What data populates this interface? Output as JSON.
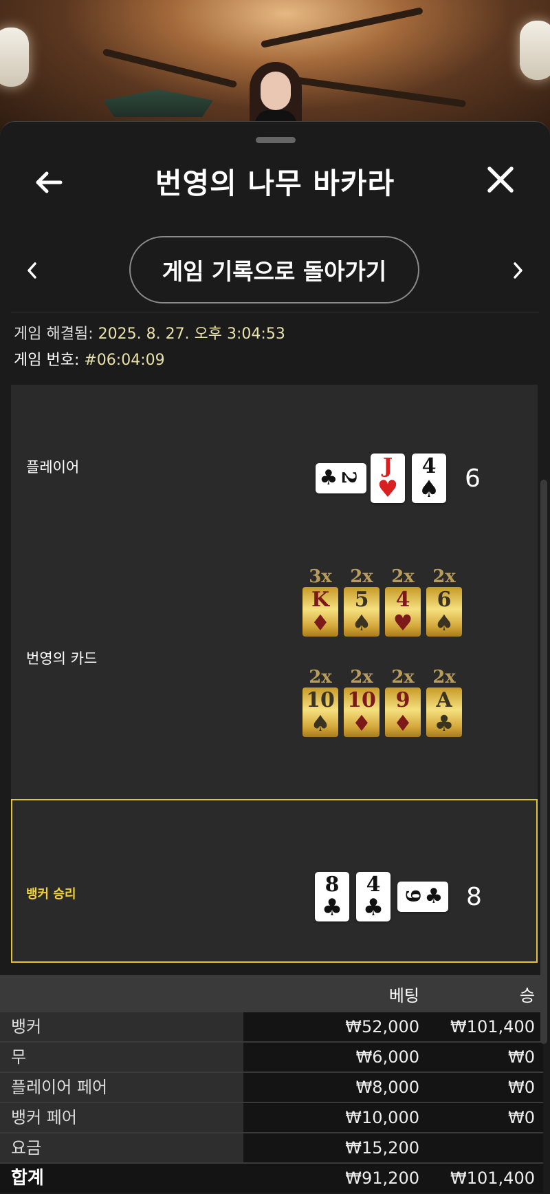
{
  "header": {
    "title": "번영의 나무 바카라"
  },
  "nav": {
    "return_label": "게임 기록으로 돌아가기"
  },
  "meta": {
    "resolved_label": "게임 해결됨:",
    "resolved_value": "2025. 8. 27. 오후 3:04:53",
    "game_no_label": "게임 번호:",
    "game_no_value": "#06:04:09"
  },
  "player": {
    "label": "플레이어",
    "total": "6",
    "cards": [
      {
        "rank": "2",
        "suit": "♣",
        "color": "black",
        "orientation": "sideways"
      },
      {
        "rank": "J",
        "suit": "♥",
        "color": "red"
      },
      {
        "rank": "4",
        "suit": "♠",
        "color": "black"
      }
    ]
  },
  "prosperity": {
    "label": "번영의 카드",
    "row1": [
      {
        "mult": "3x",
        "rank": "K",
        "suit": "♦",
        "color": "red"
      },
      {
        "mult": "2x",
        "rank": "5",
        "suit": "♠",
        "color": "black"
      },
      {
        "mult": "2x",
        "rank": "4",
        "suit": "♥",
        "color": "red"
      },
      {
        "mult": "2x",
        "rank": "6",
        "suit": "♠",
        "color": "black"
      }
    ],
    "row2": [
      {
        "mult": "2x",
        "rank": "10",
        "suit": "♠",
        "color": "black"
      },
      {
        "mult": "2x",
        "rank": "10",
        "suit": "♦",
        "color": "red"
      },
      {
        "mult": "2x",
        "rank": "9",
        "suit": "♦",
        "color": "red"
      },
      {
        "mult": "2x",
        "rank": "A",
        "suit": "♣",
        "color": "black"
      }
    ]
  },
  "banker": {
    "label": "뱅커 승리",
    "total": "8",
    "cards": [
      {
        "rank": "8",
        "suit": "♣",
        "color": "black"
      },
      {
        "rank": "4",
        "suit": "♣",
        "color": "black"
      },
      {
        "rank": "9",
        "suit": "♣",
        "color": "black",
        "orientation": "sideways"
      }
    ]
  },
  "bets": {
    "col_bet": "베팅",
    "col_win": "승",
    "rows": [
      {
        "name": "뱅커",
        "bet": "₩52,000",
        "win": "₩101,400"
      },
      {
        "name": "무",
        "bet": "₩6,000",
        "win": "₩0"
      },
      {
        "name": "플레이어 페어",
        "bet": "₩8,000",
        "win": "₩0"
      },
      {
        "name": "뱅커 페어",
        "bet": "₩10,000",
        "win": "₩0"
      },
      {
        "name": "요금",
        "bet": "₩15,200",
        "win": ""
      }
    ],
    "total": {
      "name": "합계",
      "bet": "₩91,200",
      "win": "₩101,400"
    }
  },
  "colors": {
    "accent_gold": "#e3c531",
    "meta_value": "#e8e1a9"
  },
  "icons": {
    "back": "arrow-left-icon",
    "close": "close-icon",
    "prev": "chevron-left-icon",
    "next": "chevron-right-icon"
  }
}
